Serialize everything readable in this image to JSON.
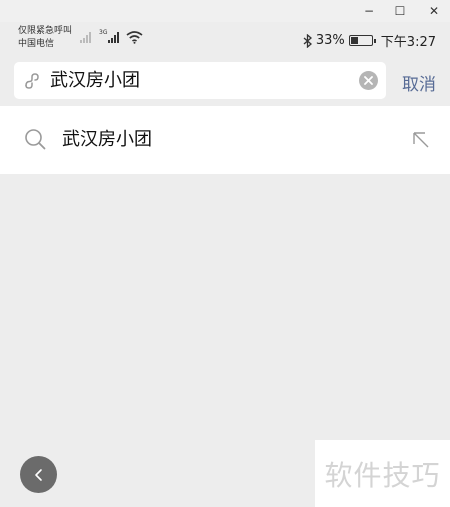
{
  "window": {
    "minimize": "−",
    "maximize": "☐",
    "close": "✕"
  },
  "status_bar": {
    "carrier_line1": "仅限紧急呼叫",
    "carrier_line2": "中国电信",
    "network_label": "3G",
    "battery_percent": "33%",
    "battery_level": 0.33,
    "time": "下午3:27",
    "icons": [
      "signal-icon",
      "wifi-icon",
      "bluetooth-icon",
      "battery-icon"
    ]
  },
  "search": {
    "query": "武汉房小团",
    "cancel_label": "取消",
    "icons": [
      "mini-program-icon",
      "clear-icon"
    ]
  },
  "suggestions": [
    {
      "text": "武汉房小团",
      "icons": [
        "search-icon",
        "fill-arrow-icon"
      ]
    }
  ],
  "overlay": {
    "watermark": "软件技巧"
  },
  "colors": {
    "background": "#ededed",
    "link": "#576b95",
    "back_button": "#6b6b6b"
  }
}
